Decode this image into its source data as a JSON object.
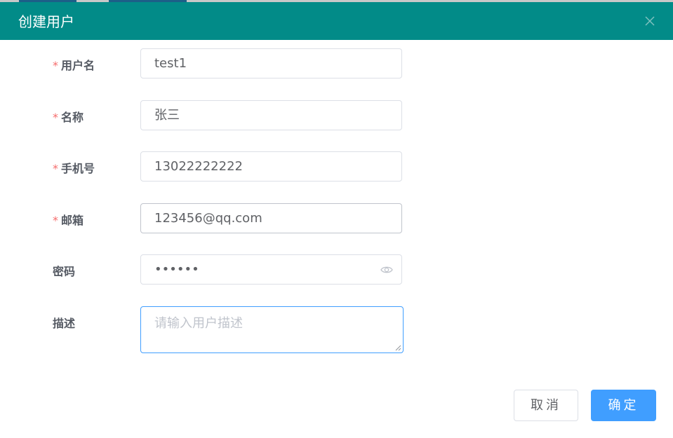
{
  "dialog": {
    "title": "创建用户"
  },
  "form": {
    "username": {
      "label": "用户名",
      "required_mark": "*",
      "value": "test1"
    },
    "name": {
      "label": "名称",
      "required_mark": "*",
      "value": "张三"
    },
    "phone": {
      "label": "手机号",
      "required_mark": "*",
      "value": "13022222222"
    },
    "email": {
      "label": "邮箱",
      "required_mark": "*",
      "value": "123456@qq.com"
    },
    "password": {
      "label": "密码",
      "value": "••••••"
    },
    "description": {
      "label": "描述",
      "placeholder": "请输入用户描述",
      "value": ""
    }
  },
  "footer": {
    "cancel_label": "取消",
    "confirm_label": "确定"
  },
  "colors": {
    "header": "#028b88",
    "primary": "#409eff",
    "required": "#f56c6c"
  },
  "icons": {
    "close": "close-icon",
    "password_toggle": "eye-icon"
  }
}
